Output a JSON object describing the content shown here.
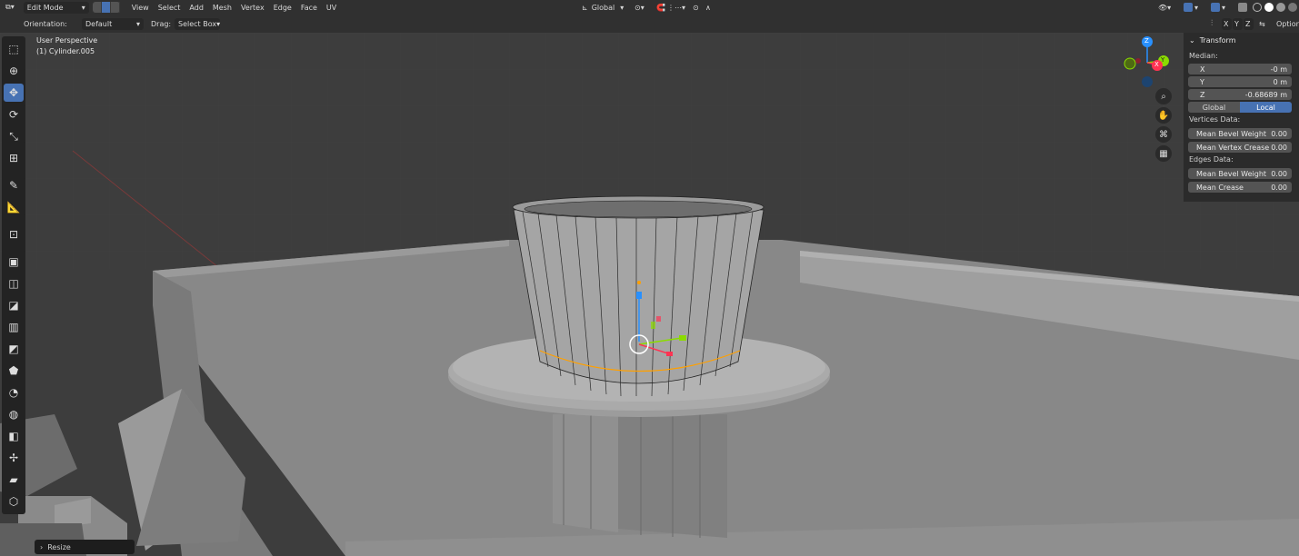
{
  "header": {
    "mode": "Edit Mode",
    "menus": [
      "View",
      "Select",
      "Add",
      "Mesh",
      "Vertex",
      "Edge",
      "Face",
      "UV"
    ],
    "transform_orientation": "Global",
    "orientation_label": "Orientation:",
    "orientation_value": "Default",
    "drag_label": "Drag:",
    "drag_value": "Select Box",
    "options": "Options",
    "axis_toggles": [
      "X",
      "Y",
      "Z"
    ]
  },
  "viewport": {
    "view_name": "User Perspective",
    "object_name": "(1) Cylinder.005"
  },
  "npanel": {
    "title": "Transform",
    "median_label": "Median:",
    "x_label": "X",
    "x_value": "-0 m",
    "y_label": "Y",
    "y_value": "0 m",
    "z_label": "Z",
    "z_value": "-0.68689 m",
    "space_global": "Global",
    "space_local": "Local",
    "vertices_label": "Vertices Data:",
    "mean_bevel_weight_v_label": "Mean Bevel Weight",
    "mean_bevel_weight_v": "0.00",
    "mean_vertex_crease_label": "Mean Vertex Crease",
    "mean_vertex_crease": "0.00",
    "edges_label": "Edges Data:",
    "mean_bevel_weight_e_label": "Mean Bevel Weight",
    "mean_bevel_weight_e": "0.00",
    "mean_crease_label": "Mean Crease",
    "mean_crease": "0.00"
  },
  "gizmo": {
    "x": "X",
    "y": "Y",
    "z": "Z"
  },
  "operator_panel": {
    "label": "Resize"
  },
  "colors": {
    "accent": "#4772b3",
    "x_axis": "#ff3352",
    "y_axis": "#8bdc00",
    "z_axis": "#2890ff",
    "edge_select": "#ffa000"
  }
}
